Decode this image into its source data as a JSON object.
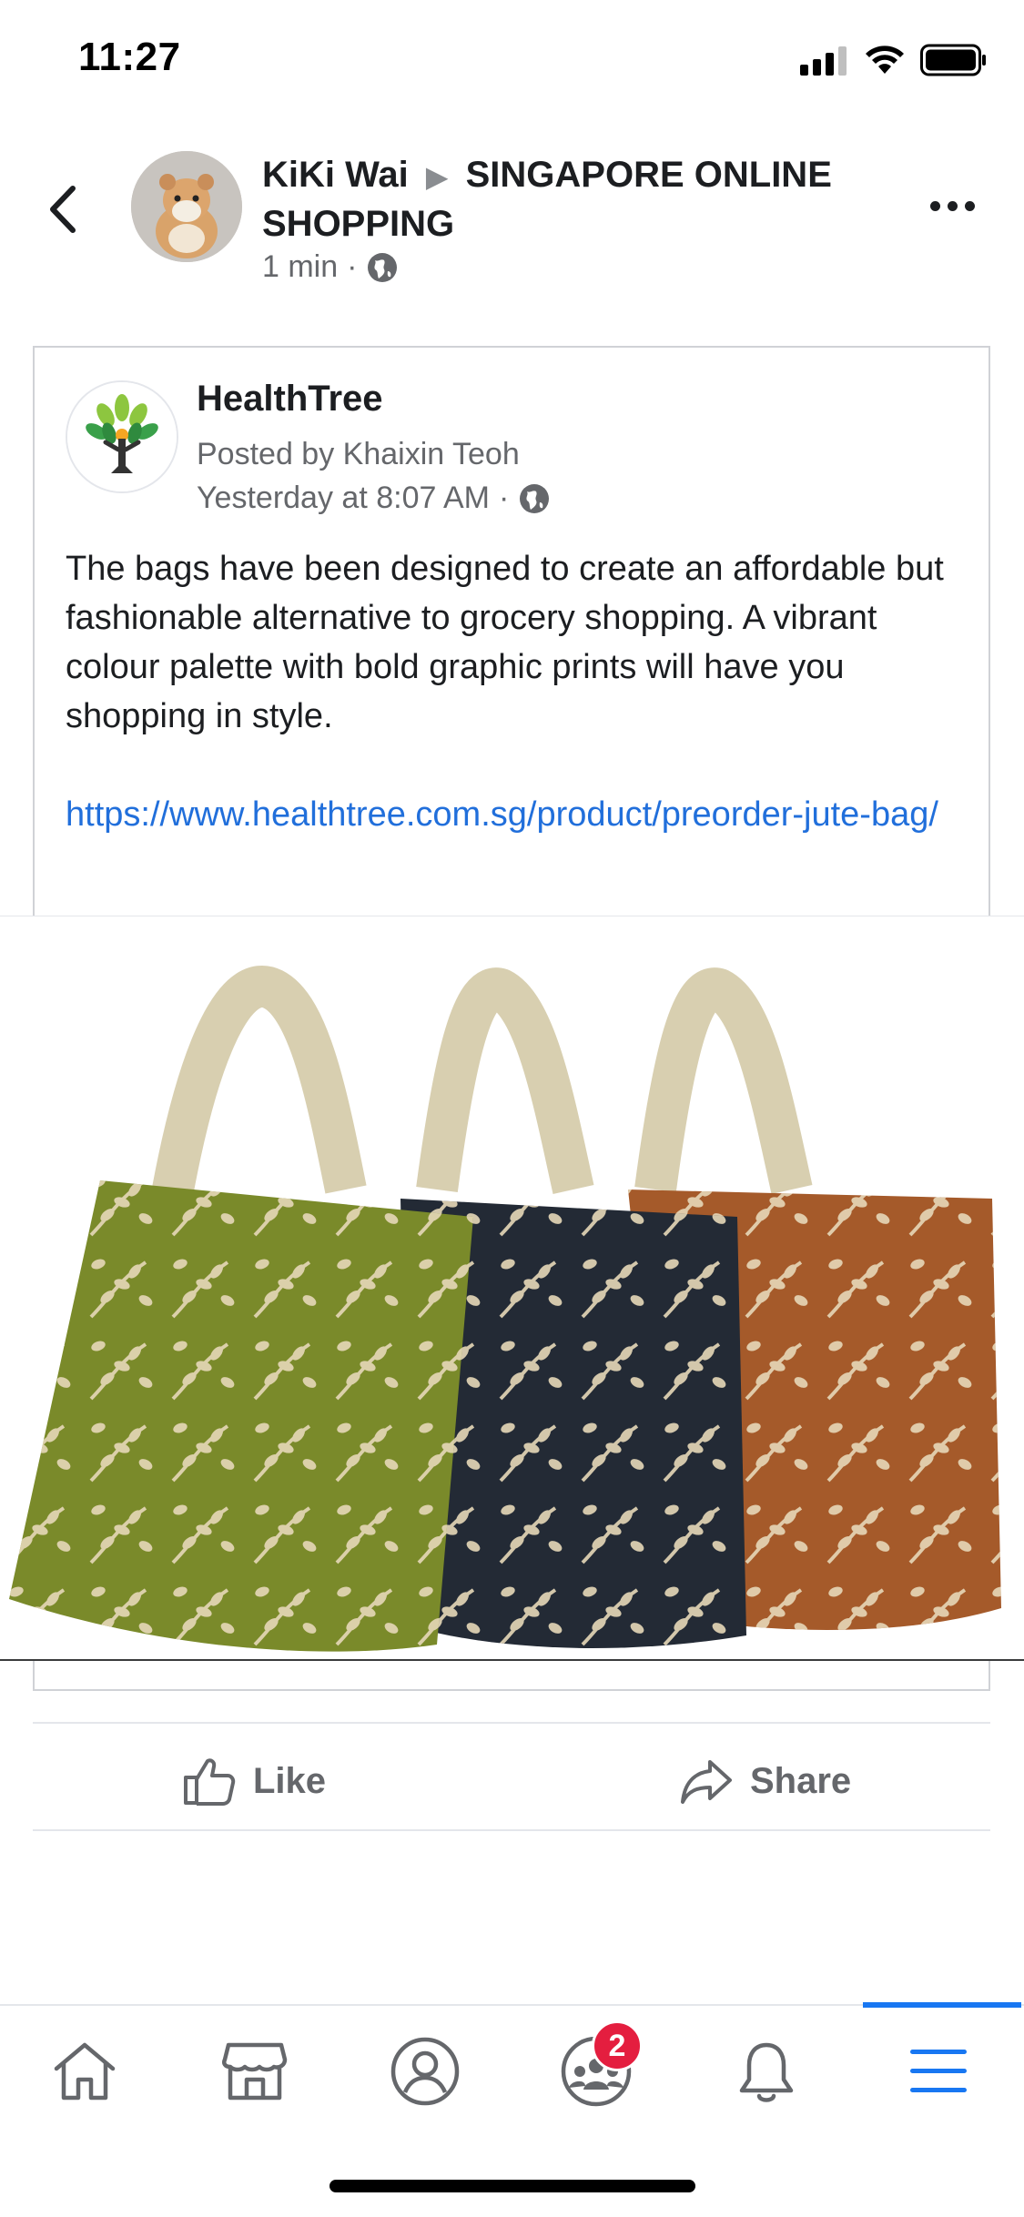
{
  "status_bar": {
    "time": "11:27",
    "icons": [
      "cellular-signal-icon",
      "wifi-icon",
      "battery-icon"
    ]
  },
  "header": {
    "author": "KiKi Wai",
    "separator_icon": "triangle-right-icon",
    "group": "SINGAPORE ONLINE SHOPPING",
    "time": "1 min",
    "dot": "·",
    "privacy_icon": "globe-icon"
  },
  "shared_post": {
    "page_name": "HealthTree",
    "posted_by": "Posted by Khaixin Teoh",
    "time": "Yesterday at 8:07 AM",
    "dot": "·",
    "privacy_icon": "globe-icon",
    "body": "The bags have been designed to create an affordable but fashionable alternative to grocery shopping. A vibrant colour palette with bold graphic prints will have you shopping in style.",
    "link": "https://www.healthtree.com.sg/product/preorder-jute-bag/"
  },
  "actions": {
    "like_label": "Like",
    "share_label": "Share"
  },
  "tabbar": {
    "tabs": [
      "home-icon",
      "marketplace-icon",
      "profile-icon",
      "groups-icon",
      "notifications-icon",
      "menu-icon"
    ],
    "groups_badge": "2",
    "active_tab": "menu-icon"
  },
  "colors": {
    "link": "#216fdb",
    "accent": "#1877f2",
    "badge": "#e41e3f",
    "secondary_text": "#65676b",
    "bag_green": "#7a8a2a",
    "bag_navy": "#232a35",
    "bag_rust": "#a55a2a",
    "bag_handle": "#d8cfb0"
  }
}
